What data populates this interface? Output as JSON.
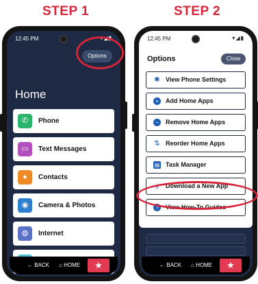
{
  "step1": {
    "title": "STEP 1"
  },
  "step2": {
    "title": "STEP 2"
  },
  "phone1": {
    "time": "12:45 PM",
    "status_icons": "▾◢▮",
    "options_label": "Options",
    "home_title": "Home",
    "apps": [
      {
        "label": "Phone",
        "icon": "phone-icon",
        "glyph": "✆",
        "color": "#2bb56a"
      },
      {
        "label": "Text Messages",
        "icon": "message-icon",
        "glyph": "▭",
        "color": "#b44fc0"
      },
      {
        "label": "Contacts",
        "icon": "contacts-icon",
        "glyph": "●",
        "color": "#f08a24"
      },
      {
        "label": "Camera & Photos",
        "icon": "camera-icon",
        "glyph": "◉",
        "color": "#2f7fd0"
      },
      {
        "label": "Internet",
        "icon": "globe-icon",
        "glyph": "◍",
        "color": "#5b73c7"
      },
      {
        "label": "",
        "icon": "app-icon",
        "glyph": "",
        "color": "#4cc3d9"
      }
    ],
    "nav": {
      "back": "BACK",
      "home": "HOME",
      "star": "★"
    }
  },
  "phone2": {
    "time": "12:45 PM",
    "status_icons": "▾◢▮",
    "heading": "Options",
    "close_label": "Close",
    "menu": [
      {
        "label": "View Phone Settings",
        "icon": "gear-icon",
        "glyph": "✱",
        "style": "plain"
      },
      {
        "label": "Add Home Apps",
        "icon": "plus-circle-icon",
        "glyph": "+",
        "style": "round"
      },
      {
        "label": "Remove Home Apps",
        "icon": "minus-circle-icon",
        "glyph": "−",
        "style": "round"
      },
      {
        "label": "Reorder Home Apps",
        "icon": "reorder-icon",
        "glyph": "⇅",
        "style": "plain"
      },
      {
        "label": "Task Manager",
        "icon": "clipboard-icon",
        "glyph": "▤",
        "style": "square"
      },
      {
        "label": "Download a New App",
        "icon": "download-icon",
        "glyph": "⤓",
        "style": "plain"
      },
      {
        "label": "View How-To Guides",
        "icon": "help-icon",
        "glyph": "?",
        "style": "round"
      }
    ],
    "nav": {
      "back": "BACK",
      "home": "HOME",
      "star": "★"
    }
  },
  "colors": {
    "accent_red": "#d6243a",
    "screen_navy": "#1e2a44",
    "link_blue": "#1e5fb4"
  }
}
